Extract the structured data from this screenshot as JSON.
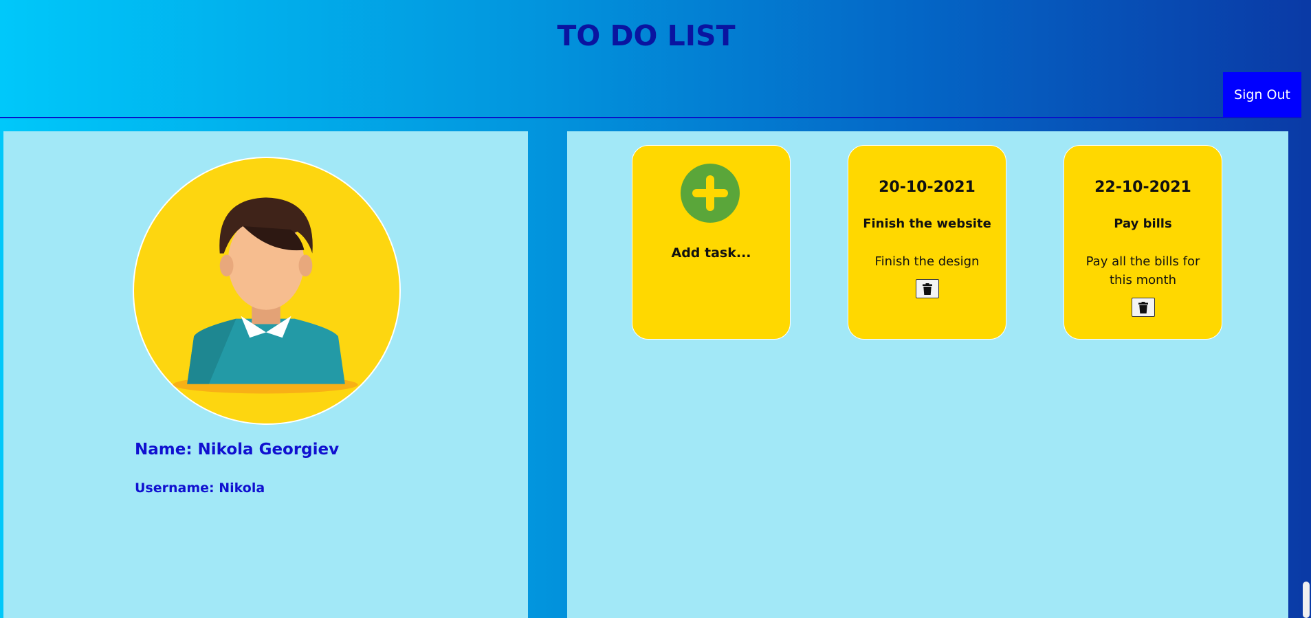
{
  "header": {
    "title": "TO DO LIST",
    "signout_label": "Sign Out"
  },
  "profile": {
    "name_text": "Name: Nikola Georgiev",
    "username_text": "Username: Nikola",
    "avatar_icon": "user-avatar-icon"
  },
  "tasks": {
    "add_label": "Add task...",
    "add_icon": "plus-circle-icon",
    "delete_icon": "trash-icon",
    "items": [
      {
        "date": "20-10-2021",
        "title": "Finish the website",
        "description": "Finish the design"
      },
      {
        "date": "22-10-2021",
        "title": "Pay bills",
        "description": "Pay all the bills for this month"
      }
    ]
  },
  "colors": {
    "header_gradient_start": "#00c8fa",
    "header_gradient_end": "#0a3aa6",
    "title_color": "#0a14a0",
    "signout_bg": "#0000ff",
    "panel_bg": "#a2e8f7",
    "card_bg": "#ffd800",
    "plus_bg": "#5aa63a",
    "profile_text": "#1010d0"
  }
}
